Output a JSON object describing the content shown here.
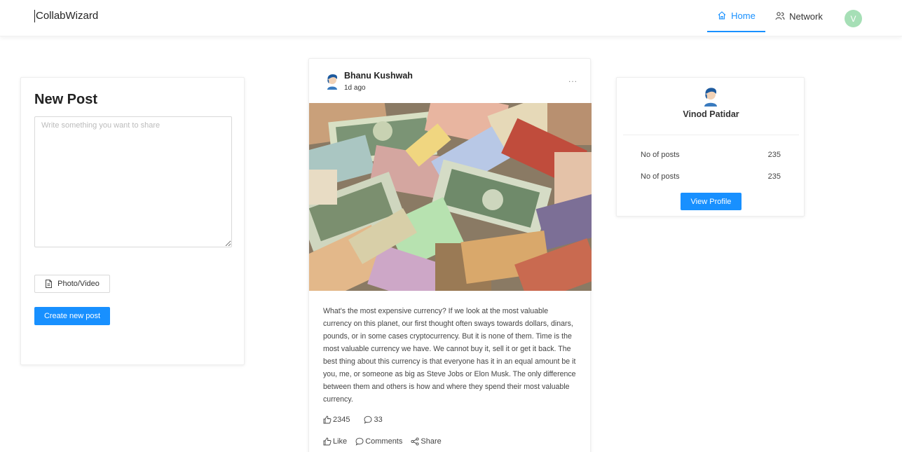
{
  "header": {
    "brand": "CollabWizard",
    "nav": [
      {
        "label": "Home",
        "icon": "home-icon",
        "active": true
      },
      {
        "label": "Network",
        "icon": "network-icon",
        "active": false
      }
    ],
    "avatar_initial": "V",
    "accent": "#1890ff",
    "avatar_color": "#a6dfb6"
  },
  "new_post": {
    "title": "New Post",
    "placeholder": "Write something you want to share",
    "photo_button": "Photo/Video",
    "create_button": "Create new post"
  },
  "post": {
    "author": "Bhanu Kushwah",
    "time": "1d ago",
    "more": "...",
    "body": "What's the most expensive currency? If we look at the most valuable currency on this planet, our first thought often sways towards dollars, dinars, pounds, or in some cases cryptocurrency. But it is none of them. Time is the most valuable currency we have. We cannot buy it, sell it or get it back. The best thing about this currency is that everyone has it in an equal amount be it you, me, or someone as big as Steve Jobs or Elon Musk. The only difference between them and others is how and where they spend their most valuable currency.",
    "likes": "2345",
    "comments": "33",
    "actions": {
      "like": "Like",
      "comments": "Comments",
      "share": "Share"
    }
  },
  "profile": {
    "name": "Vinod Patidar",
    "stats": [
      {
        "label": "No of posts",
        "value": "235"
      },
      {
        "label": "No of posts",
        "value": "235"
      }
    ],
    "view_button": "View Profile"
  }
}
